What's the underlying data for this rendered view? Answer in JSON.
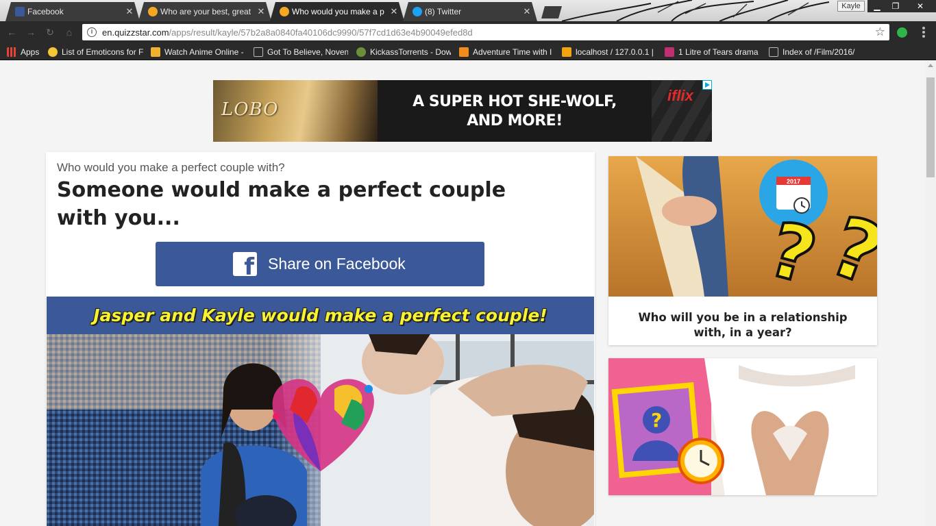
{
  "browser": {
    "tabs": [
      {
        "title": "Facebook",
        "icon": "facebook-icon",
        "icon_color": "#3b5998",
        "active": false
      },
      {
        "title": "Who are your best, great",
        "icon": "quizzstar-icon",
        "icon_color": "#f5a623",
        "active": false
      },
      {
        "title": "Who would you make a p",
        "icon": "quizzstar-icon",
        "icon_color": "#f5a623",
        "active": true
      },
      {
        "title": "(8) Twitter",
        "icon": "twitter-icon",
        "icon_color": "#1da1f2",
        "active": false
      }
    ],
    "profile_name": "Kayle",
    "url_host": "en.quizzstar.com",
    "url_path": "/apps/result/kayle/57b2a8a0840fa40106dc9990/57f7cd1d63e4b90049efed8d",
    "bookmarks": [
      {
        "label": "Apps",
        "icon": "apps-grid-icon"
      },
      {
        "label": "List of Emoticons for F",
        "icon": "emoticon-icon"
      },
      {
        "label": "Watch Anime Online -",
        "icon": "anime-icon"
      },
      {
        "label": "Got To Believe, Noven",
        "icon": "page-icon"
      },
      {
        "label": "KickassTorrents - Dow",
        "icon": "kickass-icon"
      },
      {
        "label": "Adventure Time with I",
        "icon": "k-logo-icon"
      },
      {
        "label": "localhost / 127.0.0.1 |",
        "icon": "phpmyadmin-icon"
      },
      {
        "label": "1 Litre of Tears drama",
        "icon": "k-logo-icon"
      },
      {
        "label": "Index of /Film/2016/",
        "icon": "page-icon"
      }
    ]
  },
  "ad": {
    "logo_text": "LOBO",
    "headline_line1": "A SUPER HOT SHE-WOLF,",
    "headline_line2": "AND MORE!",
    "brand": "iflix"
  },
  "result": {
    "quiz_question": "Who would you make a perfect couple with?",
    "title": "Someone would make a perfect couple with you...",
    "share_label": "Share on Facebook",
    "banner_text": "Jasper and Kayle would make a perfect couple!"
  },
  "sidebar": {
    "cards": [
      {
        "title": "Who will you be in a relationship with, in a year?",
        "calendar_year": "2017"
      },
      {
        "title": ""
      }
    ]
  },
  "colors": {
    "facebook_blue": "#3b5998",
    "banner_text_yellow": "#f7f334",
    "iflix_red": "#e62a2a"
  }
}
